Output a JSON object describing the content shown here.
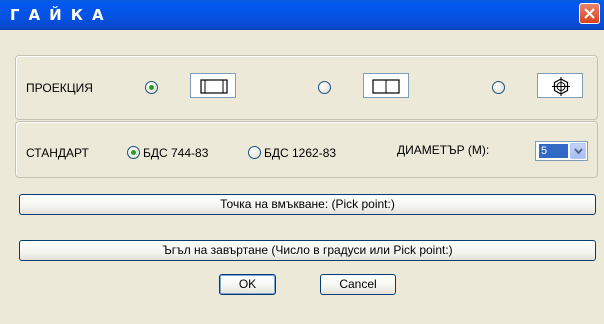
{
  "window": {
    "title": "ГАЙКА"
  },
  "projection": {
    "label": "ПРОЕКЦИЯ",
    "options": [
      {
        "checked": true,
        "icon": "nut-side-view-icon"
      },
      {
        "checked": false,
        "icon": "nut-half-view-icon"
      },
      {
        "checked": false,
        "icon": "nut-top-view-icon"
      }
    ]
  },
  "standard": {
    "label": "СТАНДАРТ",
    "options": [
      {
        "label": "БДС 744-83",
        "checked": true
      },
      {
        "label": "БДС 1262-83",
        "checked": false
      }
    ]
  },
  "diameter": {
    "label": "ДИАМЕТЪР (M):",
    "value": "5"
  },
  "buttons": {
    "insert_point": "Точка на вмъкване: (Pick point:)",
    "rotation_angle": "Ъгъл на завъртане (Число в градуси или Pick point:)",
    "ok": "OK",
    "cancel": "Cancel"
  },
  "colors": {
    "titlebar": "#0553e6",
    "dialog_bg": "#ece9d8",
    "radio_dot": "#21a121",
    "selection": "#316ac5"
  }
}
